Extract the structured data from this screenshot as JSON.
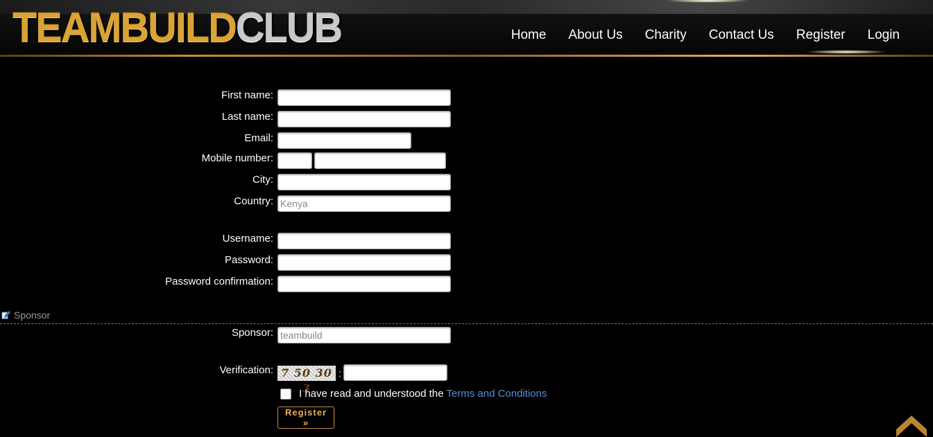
{
  "header": {
    "logo_gold": "TEAMBUILD",
    "logo_silver": "CLUB",
    "nav": [
      "Home",
      "About Us",
      "Charity",
      "Contact Us",
      "Register",
      "Login"
    ]
  },
  "form": {
    "first_name_label": "First name:",
    "last_name_label": "Last name:",
    "email_label": "Email:",
    "mobile_label": "Mobile number:",
    "city_label": "City:",
    "country_label": "Country:",
    "country_value": "Kenya",
    "username_label": "Username:",
    "password_label": "Password:",
    "password_confirmation_label": "Password confirmation:"
  },
  "sponsor_section": {
    "title": "Sponsor",
    "sponsor_label": "Sponsor:",
    "sponsor_value": "teambuild"
  },
  "verification": {
    "label": "Verification:",
    "captcha_text": "7 50 30 3",
    "separator": ":"
  },
  "terms": {
    "text": "I have read and understood the ",
    "link": "Terms and Conditions"
  },
  "register_button": "Register »",
  "colors": {
    "accent_gold": "#e8ad55",
    "link_blue": "#5a8ed6",
    "background": "#000000"
  }
}
